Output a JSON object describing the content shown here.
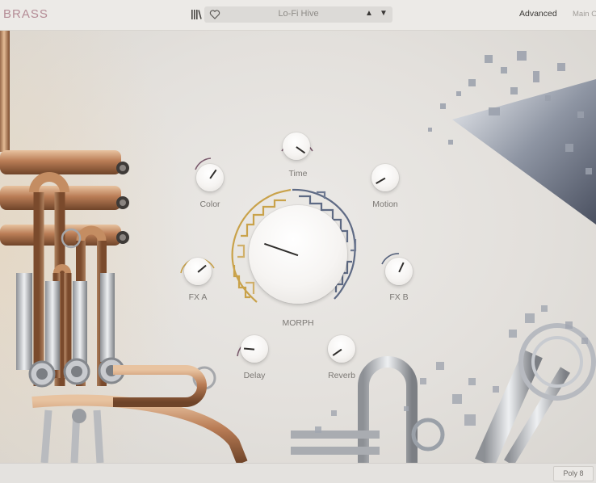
{
  "app": {
    "logo": "BRASS"
  },
  "header": {
    "preset_name": "Lo-Fi Hive",
    "prev_arrow": "▲",
    "next_arrow": "▼",
    "tab_advanced": "Advanced",
    "tab_main": "Main O"
  },
  "knobs": {
    "time": "Time",
    "color": "Color",
    "motion": "Motion",
    "fx_a": "FX A",
    "fx_b": "FX B",
    "morph": "MORPH",
    "delay": "Delay",
    "reverb": "Reverb"
  },
  "footer": {
    "poly": "Poly 8"
  },
  "colors": {
    "logo": "#b48b95",
    "morph_gold": "#c9a24a",
    "morph_blue": "#5e6a84",
    "ring_purple": "#7a5a6c",
    "ring_gold": "#c9a24a",
    "ring_blue": "#56627c"
  },
  "icons": [
    "library-icon",
    "heart-icon"
  ]
}
